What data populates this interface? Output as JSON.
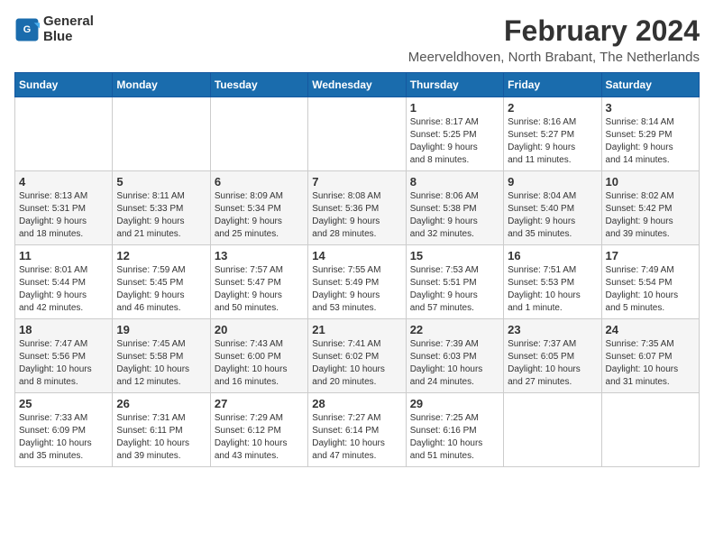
{
  "logo": {
    "line1": "General",
    "line2": "Blue"
  },
  "title": "February 2024",
  "location": "Meerveldhoven, North Brabant, The Netherlands",
  "days_of_week": [
    "Sunday",
    "Monday",
    "Tuesday",
    "Wednesday",
    "Thursday",
    "Friday",
    "Saturday"
  ],
  "weeks": [
    [
      {
        "day": "",
        "info": ""
      },
      {
        "day": "",
        "info": ""
      },
      {
        "day": "",
        "info": ""
      },
      {
        "day": "",
        "info": ""
      },
      {
        "day": "1",
        "info": "Sunrise: 8:17 AM\nSunset: 5:25 PM\nDaylight: 9 hours\nand 8 minutes."
      },
      {
        "day": "2",
        "info": "Sunrise: 8:16 AM\nSunset: 5:27 PM\nDaylight: 9 hours\nand 11 minutes."
      },
      {
        "day": "3",
        "info": "Sunrise: 8:14 AM\nSunset: 5:29 PM\nDaylight: 9 hours\nand 14 minutes."
      }
    ],
    [
      {
        "day": "4",
        "info": "Sunrise: 8:13 AM\nSunset: 5:31 PM\nDaylight: 9 hours\nand 18 minutes."
      },
      {
        "day": "5",
        "info": "Sunrise: 8:11 AM\nSunset: 5:33 PM\nDaylight: 9 hours\nand 21 minutes."
      },
      {
        "day": "6",
        "info": "Sunrise: 8:09 AM\nSunset: 5:34 PM\nDaylight: 9 hours\nand 25 minutes."
      },
      {
        "day": "7",
        "info": "Sunrise: 8:08 AM\nSunset: 5:36 PM\nDaylight: 9 hours\nand 28 minutes."
      },
      {
        "day": "8",
        "info": "Sunrise: 8:06 AM\nSunset: 5:38 PM\nDaylight: 9 hours\nand 32 minutes."
      },
      {
        "day": "9",
        "info": "Sunrise: 8:04 AM\nSunset: 5:40 PM\nDaylight: 9 hours\nand 35 minutes."
      },
      {
        "day": "10",
        "info": "Sunrise: 8:02 AM\nSunset: 5:42 PM\nDaylight: 9 hours\nand 39 minutes."
      }
    ],
    [
      {
        "day": "11",
        "info": "Sunrise: 8:01 AM\nSunset: 5:44 PM\nDaylight: 9 hours\nand 42 minutes."
      },
      {
        "day": "12",
        "info": "Sunrise: 7:59 AM\nSunset: 5:45 PM\nDaylight: 9 hours\nand 46 minutes."
      },
      {
        "day": "13",
        "info": "Sunrise: 7:57 AM\nSunset: 5:47 PM\nDaylight: 9 hours\nand 50 minutes."
      },
      {
        "day": "14",
        "info": "Sunrise: 7:55 AM\nSunset: 5:49 PM\nDaylight: 9 hours\nand 53 minutes."
      },
      {
        "day": "15",
        "info": "Sunrise: 7:53 AM\nSunset: 5:51 PM\nDaylight: 9 hours\nand 57 minutes."
      },
      {
        "day": "16",
        "info": "Sunrise: 7:51 AM\nSunset: 5:53 PM\nDaylight: 10 hours\nand 1 minute."
      },
      {
        "day": "17",
        "info": "Sunrise: 7:49 AM\nSunset: 5:54 PM\nDaylight: 10 hours\nand 5 minutes."
      }
    ],
    [
      {
        "day": "18",
        "info": "Sunrise: 7:47 AM\nSunset: 5:56 PM\nDaylight: 10 hours\nand 8 minutes."
      },
      {
        "day": "19",
        "info": "Sunrise: 7:45 AM\nSunset: 5:58 PM\nDaylight: 10 hours\nand 12 minutes."
      },
      {
        "day": "20",
        "info": "Sunrise: 7:43 AM\nSunset: 6:00 PM\nDaylight: 10 hours\nand 16 minutes."
      },
      {
        "day": "21",
        "info": "Sunrise: 7:41 AM\nSunset: 6:02 PM\nDaylight: 10 hours\nand 20 minutes."
      },
      {
        "day": "22",
        "info": "Sunrise: 7:39 AM\nSunset: 6:03 PM\nDaylight: 10 hours\nand 24 minutes."
      },
      {
        "day": "23",
        "info": "Sunrise: 7:37 AM\nSunset: 6:05 PM\nDaylight: 10 hours\nand 27 minutes."
      },
      {
        "day": "24",
        "info": "Sunrise: 7:35 AM\nSunset: 6:07 PM\nDaylight: 10 hours\nand 31 minutes."
      }
    ],
    [
      {
        "day": "25",
        "info": "Sunrise: 7:33 AM\nSunset: 6:09 PM\nDaylight: 10 hours\nand 35 minutes."
      },
      {
        "day": "26",
        "info": "Sunrise: 7:31 AM\nSunset: 6:11 PM\nDaylight: 10 hours\nand 39 minutes."
      },
      {
        "day": "27",
        "info": "Sunrise: 7:29 AM\nSunset: 6:12 PM\nDaylight: 10 hours\nand 43 minutes."
      },
      {
        "day": "28",
        "info": "Sunrise: 7:27 AM\nSunset: 6:14 PM\nDaylight: 10 hours\nand 47 minutes."
      },
      {
        "day": "29",
        "info": "Sunrise: 7:25 AM\nSunset: 6:16 PM\nDaylight: 10 hours\nand 51 minutes."
      },
      {
        "day": "",
        "info": ""
      },
      {
        "day": "",
        "info": ""
      }
    ]
  ]
}
